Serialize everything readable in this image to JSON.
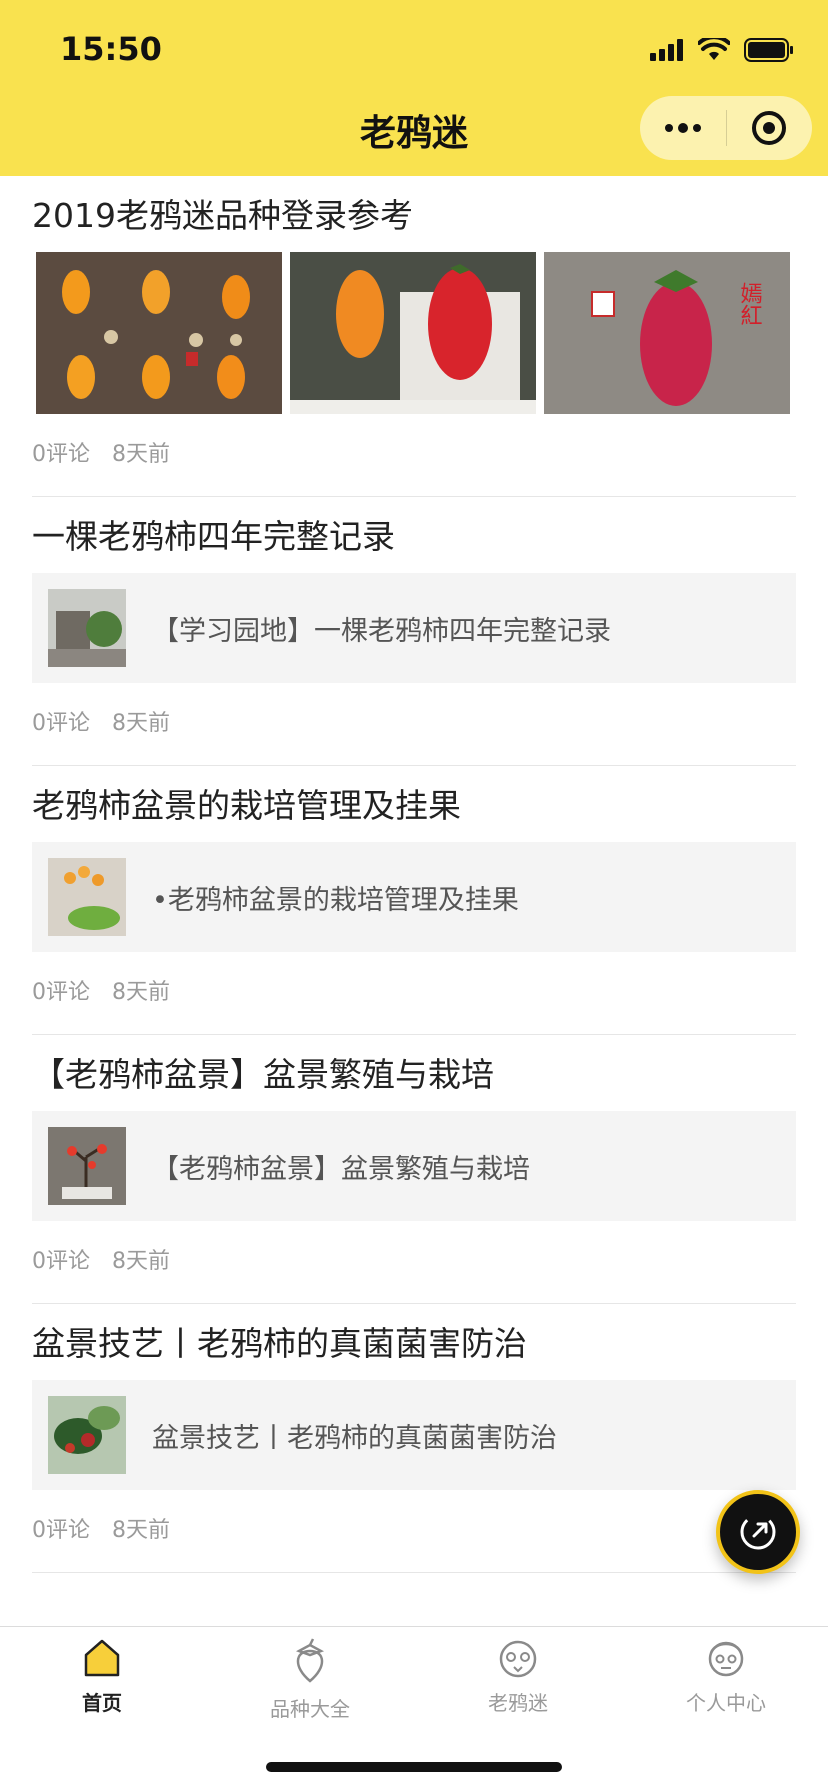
{
  "status_bar": {
    "time": "15:50"
  },
  "nav": {
    "title": "老鸦迷"
  },
  "posts": [
    {
      "title": "2019老鸦迷品种登录参考",
      "gallery_caption": "嫣紅",
      "comments": "0评论",
      "time_ago": "8天前"
    },
    {
      "title": "一棵老鸦柿四年完整记录",
      "link_text": "【学习园地】一棵老鸦柿四年完整记录",
      "comments": "0评论",
      "time_ago": "8天前"
    },
    {
      "title": "老鸦柿盆景的栽培管理及挂果",
      "link_text": "•老鸦柿盆景的栽培管理及挂果",
      "comments": "0评论",
      "time_ago": "8天前"
    },
    {
      "title": "【老鸦柿盆景】盆景繁殖与栽培",
      "link_text": "【老鸦柿盆景】盆景繁殖与栽培",
      "comments": "0评论",
      "time_ago": "8天前"
    },
    {
      "title": "盆景技艺丨老鸦柿的真菌菌害防治",
      "link_text": "盆景技艺丨老鸦柿的真菌菌害防治",
      "comments": "0评论",
      "time_ago": "8天前"
    }
  ],
  "tabbar": {
    "tabs": [
      {
        "label": "首页",
        "icon": "home-icon"
      },
      {
        "label": "品种大全",
        "icon": "persimmon-icon"
      },
      {
        "label": "老鸦迷",
        "icon": "bird-face-icon"
      },
      {
        "label": "个人中心",
        "icon": "user-avatar-icon"
      }
    ],
    "active_index": 0
  },
  "colors": {
    "brand_yellow": "#f9e24f",
    "fab_ring": "#f2c318"
  }
}
